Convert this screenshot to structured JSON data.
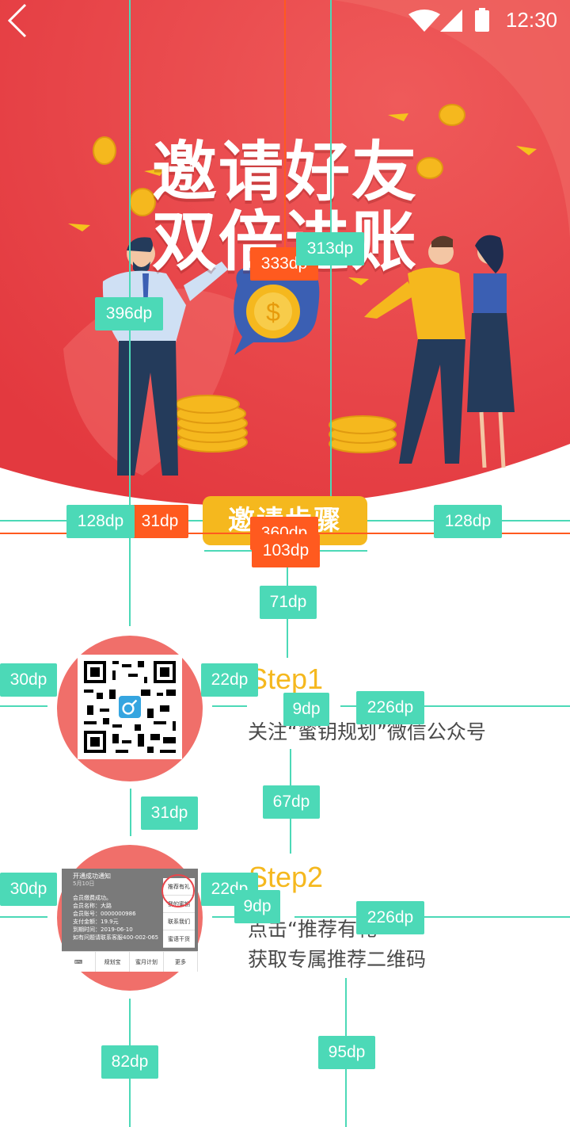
{
  "status_bar": {
    "time": "12:30"
  },
  "hero": {
    "title_line1": "邀请好友",
    "title_line2": "双倍进账",
    "colors": {
      "bg": "#e9454b",
      "accent": "#f5b81e"
    }
  },
  "cta": {
    "label": "邀请步骤"
  },
  "steps": [
    {
      "title": "Step1",
      "desc": "关注“蜜钥规划”微信公众号"
    },
    {
      "title": "Step2",
      "desc_line1": "点击“推荐有礼”",
      "desc_line2": "获取专属推荐二维码"
    }
  ],
  "wechat_shot": {
    "header": "开通成功通知",
    "date": "5月10日",
    "lines": [
      "会员缴费成功。",
      "会员名称：大路",
      "会员账号：0000000986",
      "支付金额：19.9元",
      "到期时间：2019-06-10",
      "如有问题请联系客服400-002-065"
    ],
    "menu": [
      "推荐有礼",
      "我的蜜钥",
      "联系我们",
      "蜜语干货"
    ],
    "tabs": [
      "规划宝",
      "蜜月计划",
      "更多"
    ]
  },
  "annotations": {
    "a396": "396dp",
    "a333": "333dp",
    "a313": "313dp",
    "a128l": "128dp",
    "a31a": "31dp",
    "a360": "360dp",
    "a103": "103dp",
    "a128r": "128dp",
    "a71": "71dp",
    "a30a": "30dp",
    "a22a": "22dp",
    "a9a": "9dp",
    "a226a": "226dp",
    "a31b": "31dp",
    "a67": "67dp",
    "a30b": "30dp",
    "a22b": "22dp",
    "a9b": "9dp",
    "a226b": "226dp",
    "a82": "82dp",
    "a95": "95dp"
  }
}
